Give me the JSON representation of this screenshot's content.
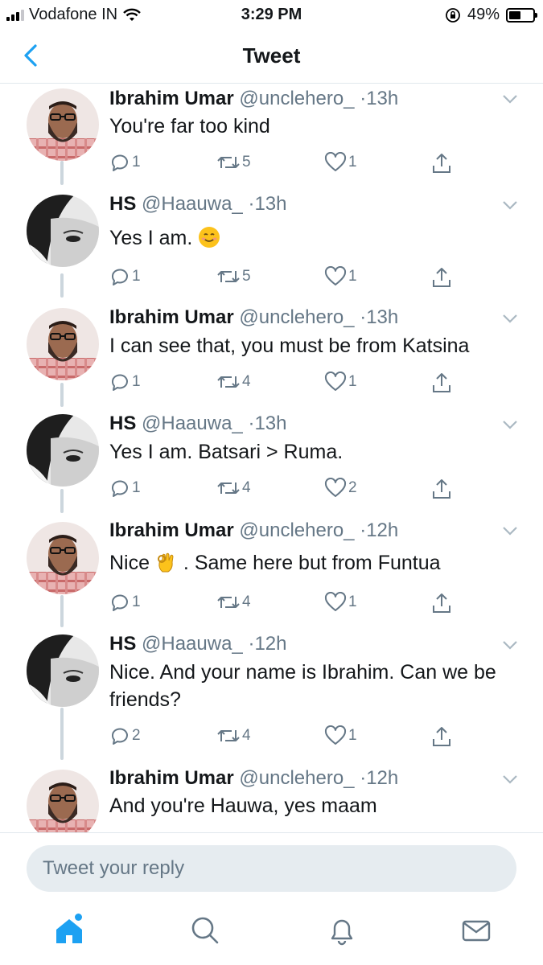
{
  "status_bar": {
    "carrier": "Vodafone IN",
    "time": "3:29 PM",
    "battery": "49%",
    "battery_level": 0.49
  },
  "nav": {
    "title": "Tweet"
  },
  "tweets": [
    {
      "name": "Ibrahim Umar",
      "handle": "@unclehero_",
      "time": "13h",
      "text": "You're far too kind",
      "replies": "1",
      "retweets": "5",
      "likes": "1"
    },
    {
      "name": "HS",
      "handle": "@Haauwa_",
      "time": "13h",
      "text": "Yes I am.",
      "emoji": "smiling-face-emoji",
      "replies": "1",
      "retweets": "5",
      "likes": "1"
    },
    {
      "name": "Ibrahim Umar",
      "handle": "@unclehero_",
      "time": "13h",
      "text": "I can see that, you must be from Katsina",
      "replies": "1",
      "retweets": "4",
      "likes": "1"
    },
    {
      "name": "HS",
      "handle": "@Haauwa_",
      "time": "13h",
      "text": "Yes I am. Batsari > Ruma.",
      "replies": "1",
      "retweets": "4",
      "likes": "2"
    },
    {
      "name": "Ibrahim Umar",
      "handle": "@unclehero_",
      "time": "12h",
      "text_before": "Nice",
      "text_after": ". Same here but from Funtua",
      "emoji": "ok-hand-emoji",
      "replies": "1",
      "retweets": "4",
      "likes": "1"
    },
    {
      "name": "HS",
      "handle": "@Haauwa_",
      "time": "12h",
      "text": "Nice. And your name is Ibrahim. Can we be friends?",
      "replies": "2",
      "retweets": "4",
      "likes": "1"
    },
    {
      "name": "Ibrahim Umar",
      "handle": "@unclehero_",
      "time": "12h",
      "text": "And you're Hauwa, yes maam"
    }
  ],
  "reply": {
    "placeholder": "Tweet your reply"
  },
  "tab_bar": {
    "items": [
      "home-icon",
      "search-icon",
      "bell-icon",
      "mail-icon"
    ]
  },
  "colors": {
    "accent": "#1da1f2",
    "text": "#14171a",
    "secondary": "#657786",
    "thread_line": "#ccd6dd"
  },
  "separator": "·"
}
